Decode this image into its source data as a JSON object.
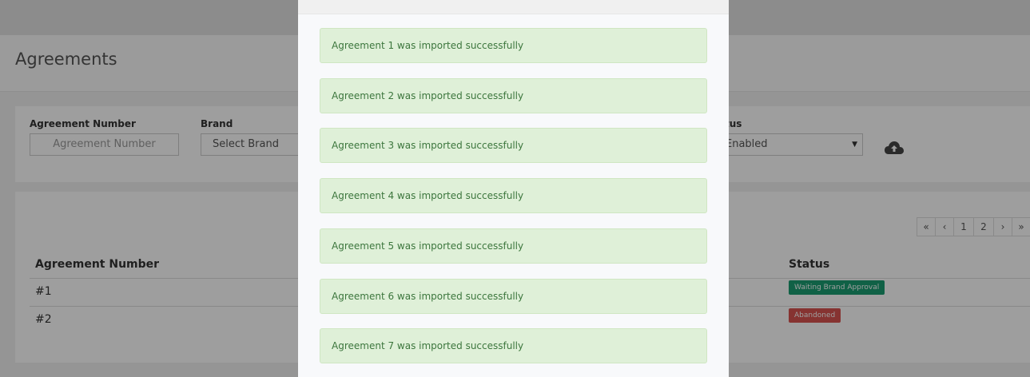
{
  "page": {
    "title": "Agreements"
  },
  "filters": {
    "agreement_number_label": "Agreement Number",
    "agreement_number_placeholder": "Agreement Number",
    "brand_label": "Brand",
    "brand_value": "Select Brand",
    "status_label": "tus",
    "status_value": "Enabled",
    "upload_icon": "cloud-upload-icon"
  },
  "pagination": {
    "first": "«",
    "prev": "‹",
    "pages": [
      "1",
      "2"
    ],
    "next": "›",
    "last": "»"
  },
  "table": {
    "columns": [
      "Agreement Number",
      "Status"
    ],
    "rows": [
      {
        "number": "#1",
        "status": "Waiting Brand Approval",
        "status_color": "#1a9d72"
      },
      {
        "number": "#2",
        "status": "Abandoned",
        "status_color": "#d9534f"
      }
    ]
  },
  "modal": {
    "alerts": [
      "Agreement 1 was imported successfully",
      "Agreement 2 was imported successfully",
      "Agreement 3 was imported successfully",
      "Agreement 4 was imported successfully",
      "Agreement 5 was imported successfully",
      "Agreement 6 was imported successfully",
      "Agreement 7 was imported successfully"
    ]
  },
  "colors": {
    "success_bg": "#dff0d8",
    "success_text": "#3c763d"
  }
}
